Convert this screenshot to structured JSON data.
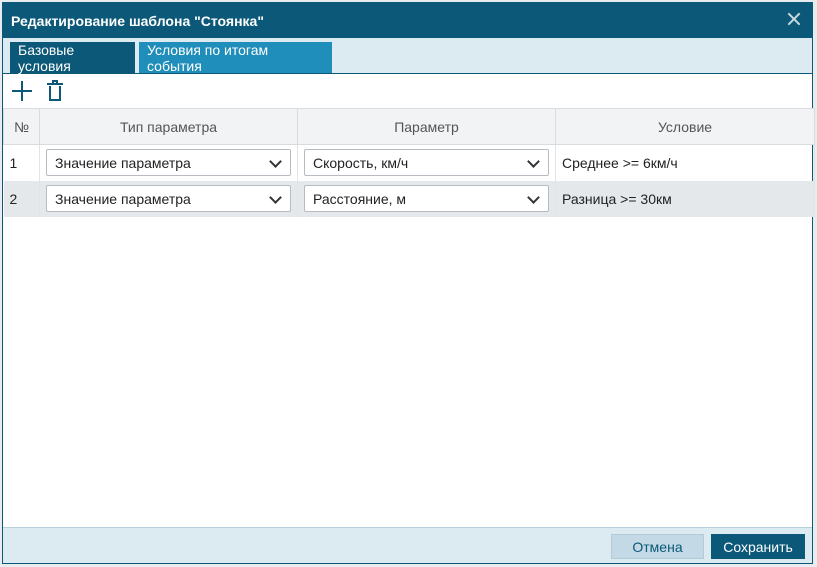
{
  "dialog": {
    "title": "Редактирование шаблона \"Стоянка\""
  },
  "tabs": [
    {
      "label": "Базовые условия"
    },
    {
      "label": "Условия по итогам события"
    }
  ],
  "table": {
    "headers": {
      "num": "№",
      "type": "Тип параметра",
      "param": "Параметр",
      "cond": "Условие"
    },
    "rows": [
      {
        "num": "1",
        "type": "Значение параметра",
        "param": "Скорость, км/ч",
        "cond": "Среднее >= 6км/ч"
      },
      {
        "num": "2",
        "type": "Значение параметра",
        "param": "Расстояние, м",
        "cond": "Разница >= 30км"
      }
    ]
  },
  "footer": {
    "cancel_label": "Отмена",
    "save_label": "Сохранить"
  },
  "icons": {
    "add": "plus-icon",
    "delete": "trash-icon",
    "close": "close-icon",
    "dropdown": "chevron-down-icon"
  }
}
